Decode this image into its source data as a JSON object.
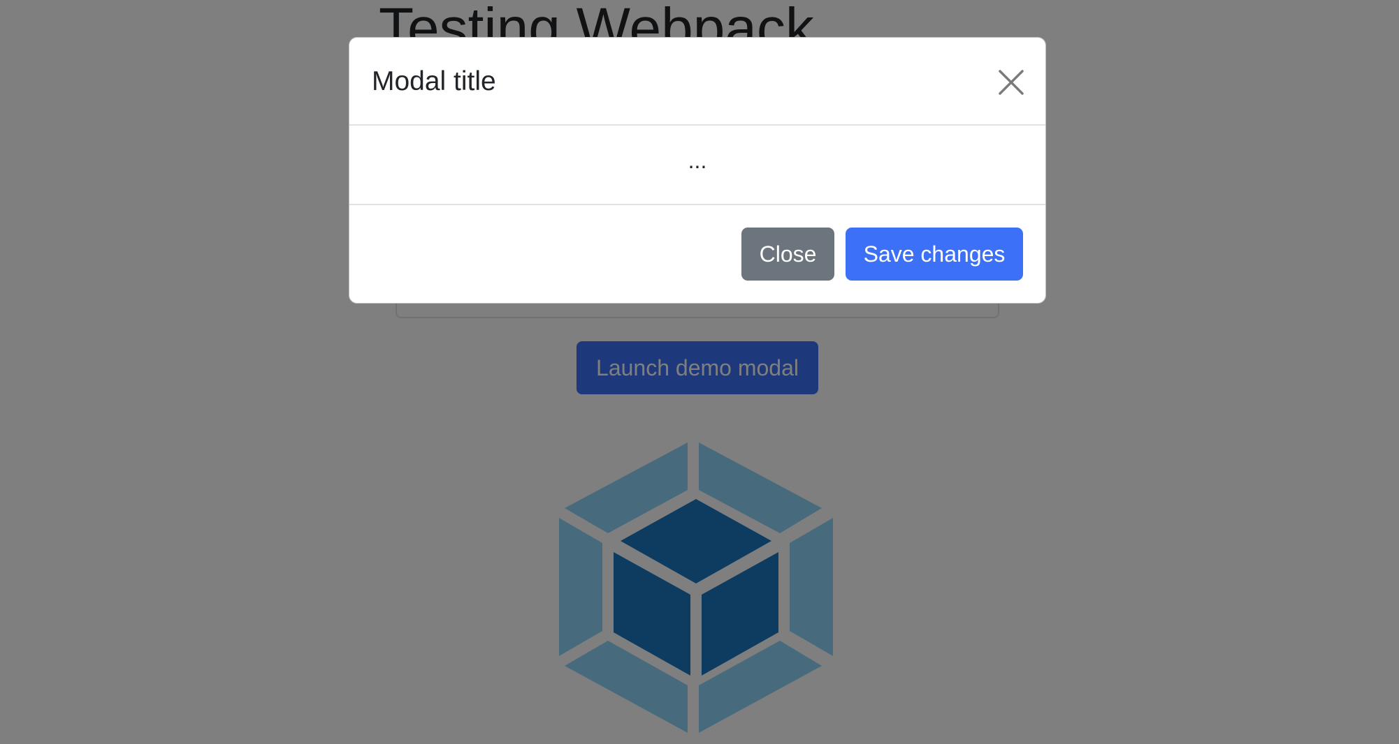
{
  "page": {
    "title": "Testing Webpack",
    "launch_button_label": "Launch demo modal",
    "logo_icon": "webpack-logo-icon"
  },
  "modal": {
    "title": "Modal title",
    "close_icon": "close-icon",
    "body_text": "...",
    "footer": {
      "close_label": "Close",
      "save_label": "Save changes"
    }
  },
  "colors": {
    "primary": "#3b70f7",
    "secondary": "#6c757d",
    "backdrop": "rgba(0,0,0,0.5)",
    "logo_outer": "#8ed6fb",
    "logo_inner": "#1c78c0"
  }
}
